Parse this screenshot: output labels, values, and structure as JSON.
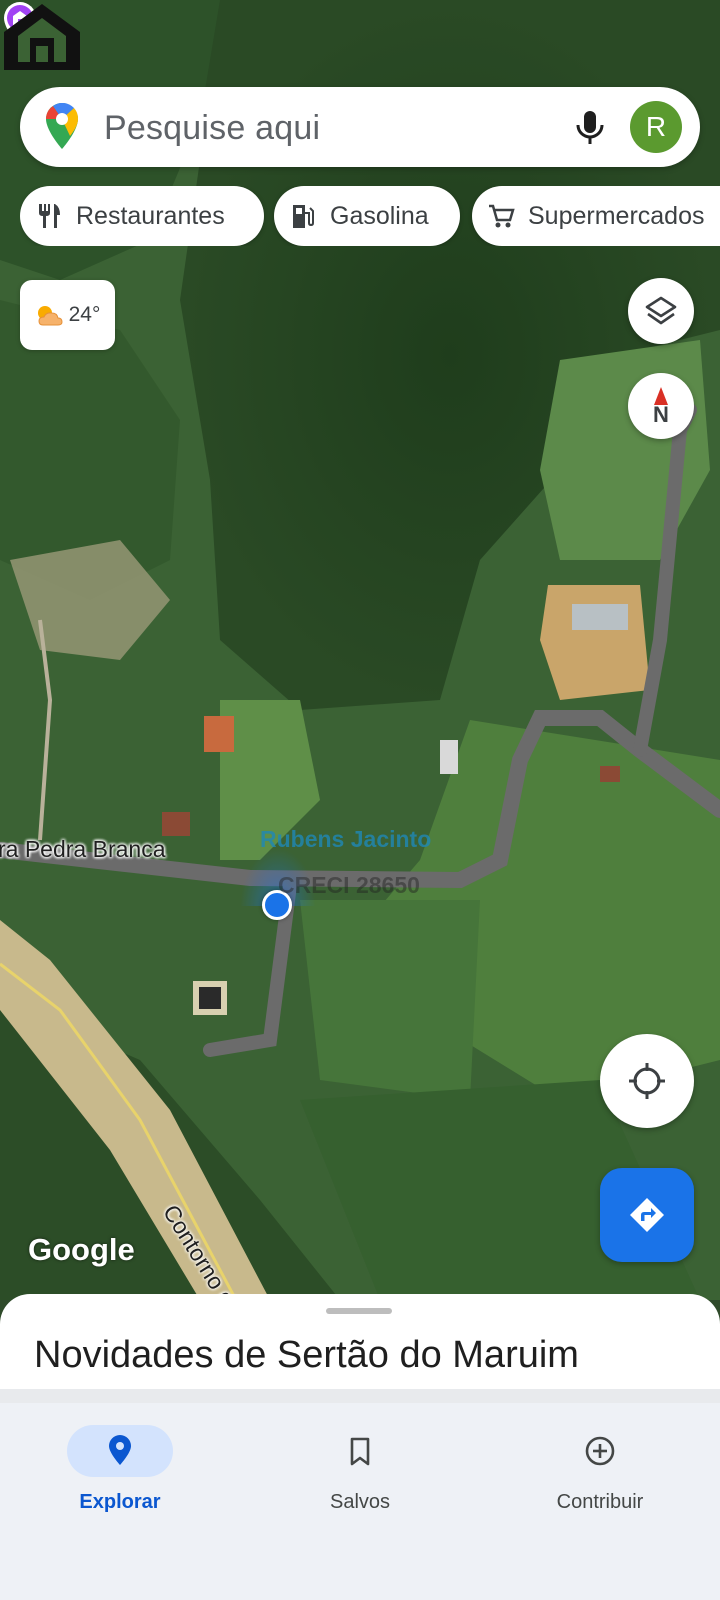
{
  "search": {
    "placeholder": "Pesquise aqui",
    "avatar_letter": "R"
  },
  "chips": [
    {
      "label": "Restaurantes",
      "icon": "fork-knife-icon"
    },
    {
      "label": "Gasolina",
      "icon": "gas-station-icon"
    },
    {
      "label": "Supermercados",
      "icon": "cart-icon"
    }
  ],
  "weather": {
    "temperature": "24°",
    "icon": "partly-cloudy-icon"
  },
  "compass": {
    "label": "N"
  },
  "map_labels": {
    "place": "ra Pedra Branca",
    "road": "Contorno da",
    "google": "Google",
    "watermark_name": "Rubens Jacinto",
    "watermark_creci": "CRECI 28650"
  },
  "sheet": {
    "title": "Novidades de Sertão do Maruim"
  },
  "nav": {
    "items": [
      {
        "label": "Explorar",
        "icon": "location-pin-icon",
        "active": true
      },
      {
        "label": "Salvos",
        "icon": "bookmark-icon",
        "active": false
      },
      {
        "label": "Contribuir",
        "icon": "add-circle-icon",
        "active": false
      }
    ]
  },
  "colors": {
    "accent": "#1a73e8",
    "active_nav": "#0b57d0",
    "pill": "#d3e3fd",
    "avatar": "#5b9a2f"
  }
}
